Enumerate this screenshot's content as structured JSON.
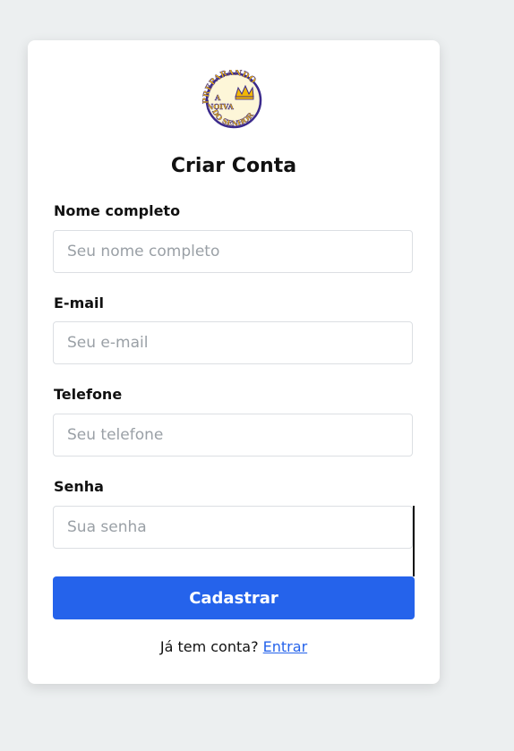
{
  "logo": {
    "line1": "PREPARANDO",
    "line2": "A",
    "line3": "NOIVA",
    "line4": "DO SENHOR",
    "icon": "crown-icon",
    "ring_color": "#3b2a8c",
    "text_color": "#f2b705"
  },
  "form": {
    "title": "Criar Conta",
    "fields": [
      {
        "label": "Nome completo",
        "placeholder": "Seu nome completo",
        "value": ""
      },
      {
        "label": "E-mail",
        "placeholder": "Seu e-mail",
        "value": ""
      },
      {
        "label": "Telefone",
        "placeholder": "Seu telefone",
        "value": ""
      },
      {
        "label": "Senha",
        "placeholder": "Sua senha",
        "value": ""
      }
    ],
    "submit_label": "Cadastrar",
    "footer_text": "Já tem conta?",
    "footer_link": "Entrar"
  },
  "colors": {
    "accent": "#2563eb",
    "background": "#eceff0",
    "card": "#ffffff"
  }
}
